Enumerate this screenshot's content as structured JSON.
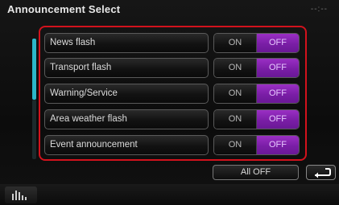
{
  "header": {
    "title": "Announcement Select",
    "clock": "--:--"
  },
  "rows": [
    {
      "label": "News flash",
      "on": "ON",
      "off": "OFF",
      "selected": "OFF"
    },
    {
      "label": "Transport flash",
      "on": "ON",
      "off": "OFF",
      "selected": "OFF"
    },
    {
      "label": "Warning/Service",
      "on": "ON",
      "off": "OFF",
      "selected": "OFF"
    },
    {
      "label": "Area weather flash",
      "on": "ON",
      "off": "OFF",
      "selected": "OFF"
    },
    {
      "label": "Event announcement",
      "on": "ON",
      "off": "OFF",
      "selected": "OFF"
    }
  ],
  "footer": {
    "all_off": "All OFF",
    "back_icon": "return-arrow-icon",
    "eq_icon": "equalizer-icon"
  },
  "colors": {
    "accent": "#7a1ea6",
    "highlight": "#d2121c",
    "scrollbar": "#2bb7c9"
  }
}
